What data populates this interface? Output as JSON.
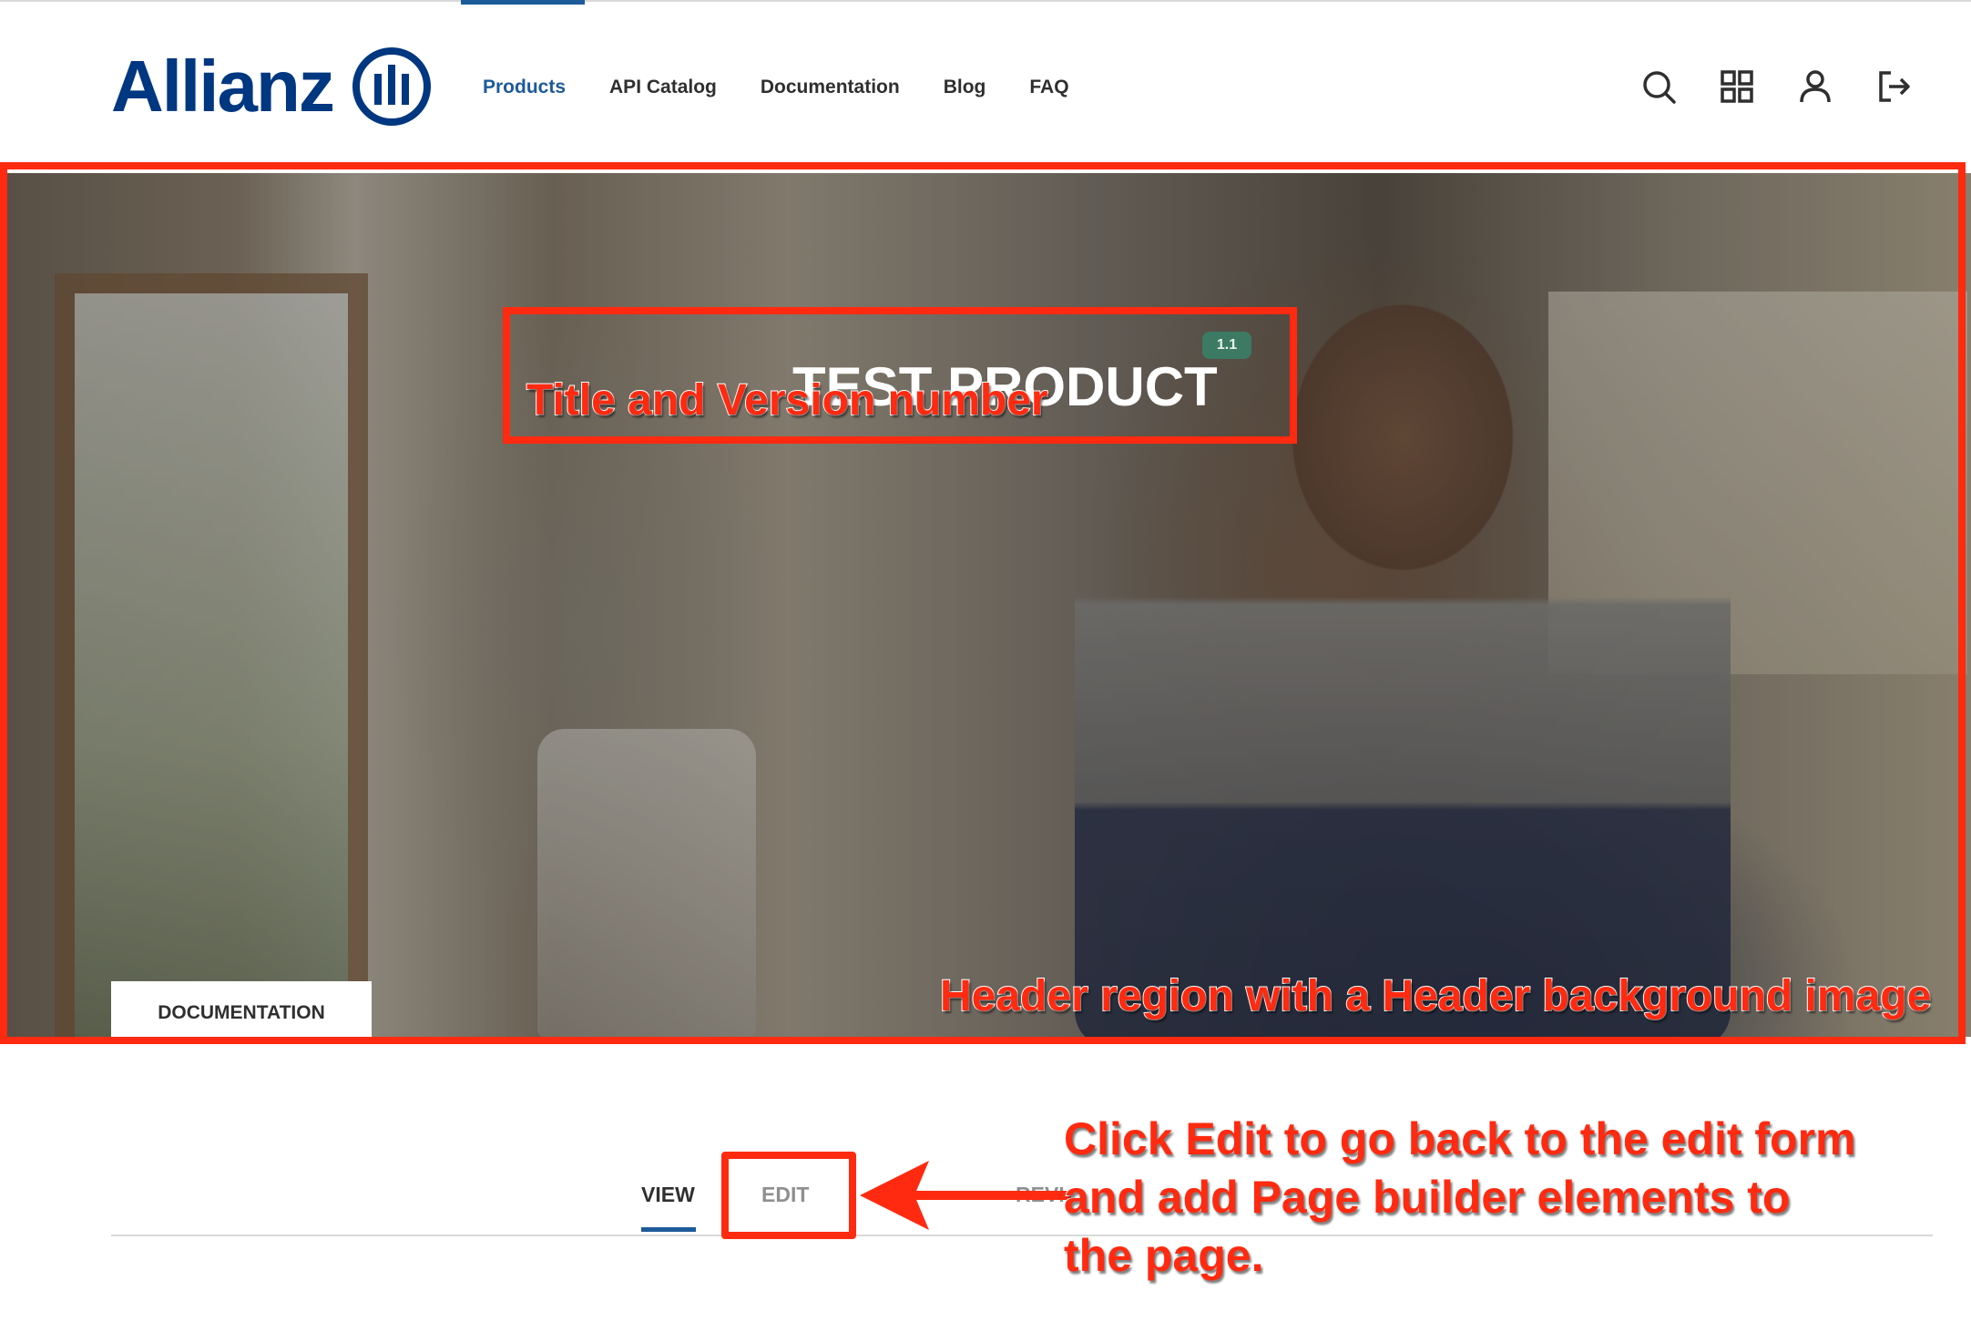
{
  "nav": {
    "logo_text": "Allianz",
    "links": [
      {
        "label": "Products",
        "active": true
      },
      {
        "label": "API Catalog",
        "active": false
      },
      {
        "label": "Documentation",
        "active": false
      },
      {
        "label": "Blog",
        "active": false
      },
      {
        "label": "FAQ",
        "active": false
      }
    ],
    "icons": [
      "search-icon",
      "grid-icon",
      "user-icon",
      "logout-icon"
    ]
  },
  "hero": {
    "title": "TEST PRODUCT",
    "version": "1.1",
    "tab_label": "DOCUMENTATION"
  },
  "annotations": {
    "title_label": "Title and Version number",
    "hero_label": "Header region with a Header background image",
    "click_label_lines": [
      "Click Edit to go back to the edit form",
      "and add Page builder elements to",
      "the page."
    ]
  },
  "tabs": {
    "view": "VIEW",
    "edit": "EDIT",
    "revisions": "REVI"
  },
  "colors": {
    "brand": "#003781",
    "accent": "#1d5a9a",
    "annotation": "#ff2a10",
    "version_badge": "#3c7a64"
  }
}
